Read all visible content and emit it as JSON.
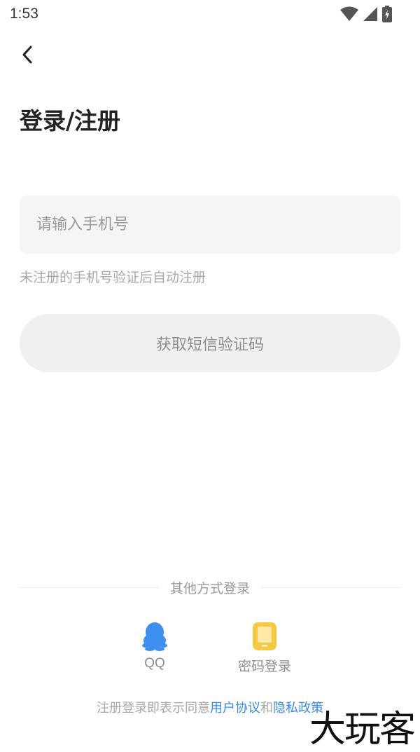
{
  "status_bar": {
    "time": "1:53",
    "icons": [
      "wifi-icon",
      "cellular-signal-icon",
      "battery-icon"
    ]
  },
  "header": {
    "back_icon": "chevron-left-icon",
    "title": "登录/注册"
  },
  "phone_input": {
    "value": "",
    "placeholder": "请输入手机号"
  },
  "hint": "未注册的手机号验证后自动注册",
  "sms_button": {
    "label": "获取短信验证码"
  },
  "other_login": {
    "divider_label": "其他方式登录",
    "options": [
      {
        "label": "QQ",
        "icon": "qq-penguin-icon",
        "color": "#3d8ff0"
      },
      {
        "label": "密码登录",
        "icon": "tablet-icon",
        "color": "#f7c843"
      }
    ]
  },
  "agreement": {
    "prefix": "注册登录即表示同意",
    "user_agreement": "用户协议",
    "conjunction": "和",
    "privacy_policy": "隐私政策",
    "link_color": "#3a8be6"
  },
  "watermark": "大玩客"
}
